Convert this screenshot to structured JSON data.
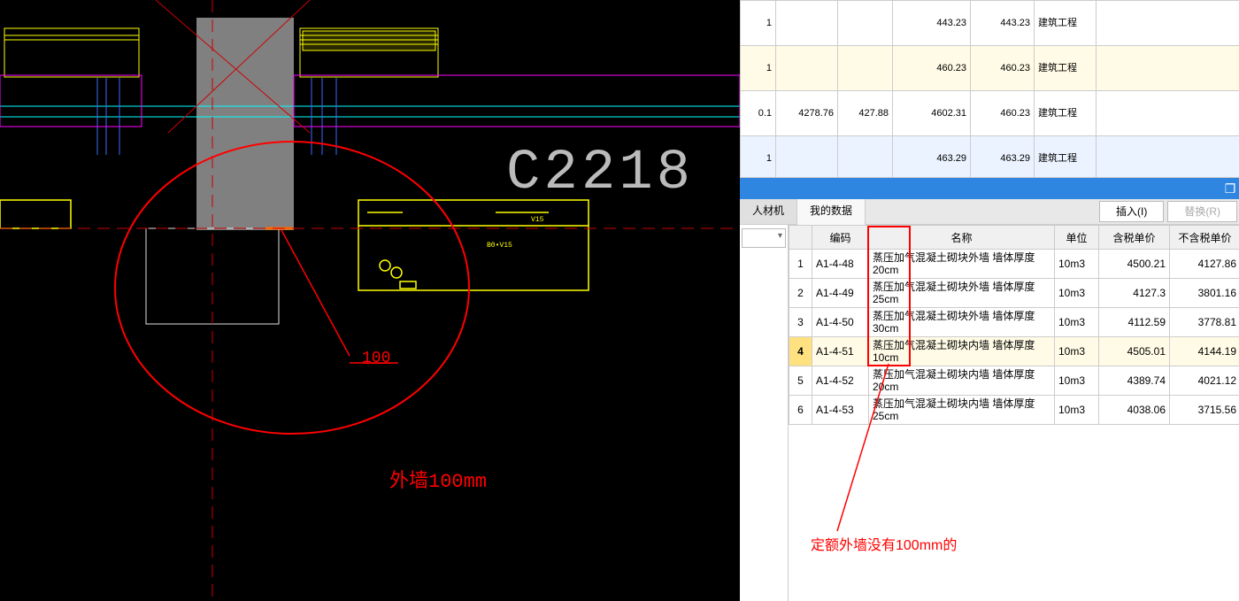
{
  "cad": {
    "ref_label": "C2218",
    "dim_value": "100",
    "annotation": "外墙100mm",
    "small_label_1": "B0•V15",
    "small_label_2": "V15"
  },
  "upper_grid": {
    "columns_visible": [
      "",
      "",
      "",
      "",
      "",
      "",
      ""
    ],
    "rows": [
      {
        "c1": "1",
        "c2": "",
        "c3": "",
        "c4": "443.23",
        "c5": "443.23",
        "c6": "建筑工程"
      },
      {
        "c1": "1",
        "c2": "",
        "c3": "",
        "c4": "460.23",
        "c5": "460.23",
        "c6": "建筑工程",
        "selected": true
      },
      {
        "c1": "0.1",
        "c2": "4278.76",
        "c3": "427.88",
        "c4": "4602.31",
        "c5": "460.23",
        "c6": "建筑工程"
      },
      {
        "c1": "1",
        "c2": "",
        "c3": "",
        "c4": "463.29",
        "c5": "463.29",
        "c6": "建筑工程",
        "light": true
      }
    ]
  },
  "tabs": {
    "tab1": "人材机",
    "tab2": "我的数据"
  },
  "buttons": {
    "insert": "插入(I)",
    "replace": "替换(R)"
  },
  "lower_grid": {
    "headers": {
      "idx": "",
      "code": "编码",
      "name": "名称",
      "unit": "单位",
      "price_tax": "含税单价",
      "price_notax": "不含税单价"
    },
    "rows": [
      {
        "idx": "1",
        "code": "A1-4-48",
        "name": "蒸压加气混凝土砌块外墙 墙体厚度20cm",
        "unit": "10m3",
        "p1": "4500.21",
        "p2": "4127.86"
      },
      {
        "idx": "2",
        "code": "A1-4-49",
        "name": "蒸压加气混凝土砌块外墙 墙体厚度25cm",
        "unit": "10m3",
        "p1": "4127.3",
        "p2": "3801.16"
      },
      {
        "idx": "3",
        "code": "A1-4-50",
        "name": "蒸压加气混凝土砌块外墙 墙体厚度30cm",
        "unit": "10m3",
        "p1": "4112.59",
        "p2": "3778.81"
      },
      {
        "idx": "4",
        "code": "A1-4-51",
        "name": "蒸压加气混凝土砌块内墙 墙体厚度10cm",
        "unit": "10m3",
        "p1": "4505.01",
        "p2": "4144.19",
        "selected": true
      },
      {
        "idx": "5",
        "code": "A1-4-52",
        "name": "蒸压加气混凝土砌块内墙 墙体厚度20cm",
        "unit": "10m3",
        "p1": "4389.74",
        "p2": "4021.12"
      },
      {
        "idx": "6",
        "code": "A1-4-53",
        "name": "蒸压加气混凝土砌块内墙 墙体厚度25cm",
        "unit": "10m3",
        "p1": "4038.06",
        "p2": "3715.56"
      }
    ]
  },
  "right_annotation": "定额外墙没有100mm的",
  "icons": {
    "maximize": "❐"
  }
}
